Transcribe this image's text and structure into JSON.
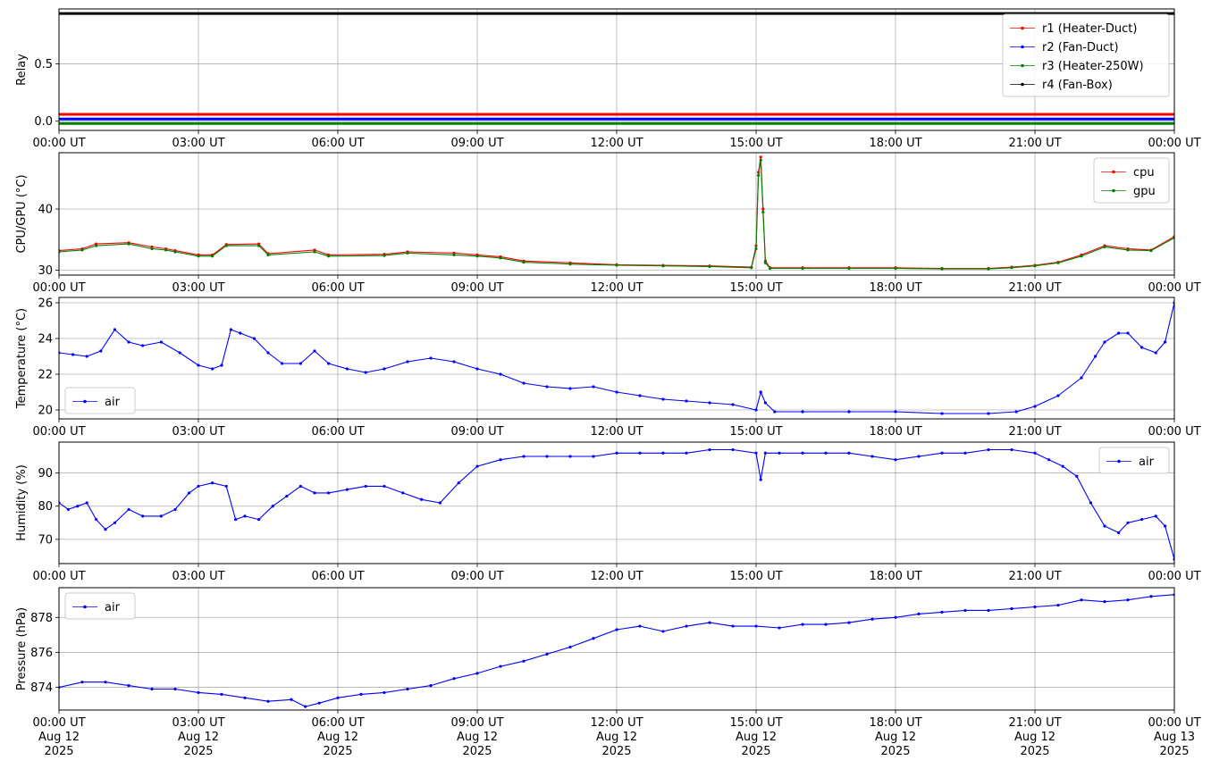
{
  "chart_data": [
    {
      "type": "line",
      "ylabel": "Relay",
      "xlim": [
        "00:00 UT",
        "00:00 UT"
      ],
      "ylim": [
        -0.08,
        0.98
      ],
      "yticks": [
        0.0,
        0.5
      ],
      "ytick_labels": [
        "0.0",
        "0.5"
      ],
      "xtick_labels": [
        "00:00 UT",
        "03:00 UT",
        "06:00 UT",
        "09:00 UT",
        "12:00 UT",
        "15:00 UT",
        "18:00 UT",
        "21:00 UT",
        "00:00 UT"
      ],
      "grid": true,
      "legend_position": "upper right",
      "series": [
        {
          "name": "r1 (Heater-Duct)",
          "color": "#ff0000",
          "x": [
            0,
            24
          ],
          "values": [
            0.06,
            0.06
          ]
        },
        {
          "name": "r2 (Fan-Duct)",
          "color": "#0000ff",
          "x": [
            0,
            24
          ],
          "values": [
            0.02,
            0.02
          ]
        },
        {
          "name": "r3 (Heater-250W)",
          "color": "#008000",
          "x": [
            0,
            24
          ],
          "values": [
            -0.02,
            -0.02
          ]
        },
        {
          "name": "r4 (Fan-Box)",
          "color": "#000000",
          "x": [
            0,
            24
          ],
          "values": [
            0.94,
            0.94
          ]
        }
      ]
    },
    {
      "type": "line",
      "ylabel": "CPU/GPU (°C)",
      "ylim": [
        29.2,
        49.2
      ],
      "yticks": [
        30,
        40
      ],
      "ytick_labels": [
        "30",
        "40"
      ],
      "xtick_labels": [
        "00:00 UT",
        "03:00 UT",
        "06:00 UT",
        "09:00 UT",
        "12:00 UT",
        "15:00 UT",
        "18:00 UT",
        "21:00 UT",
        "00:00 UT"
      ],
      "grid": true,
      "legend_position": "upper right",
      "x": [
        0,
        0.5,
        0.8,
        1.5,
        2.0,
        2.3,
        2.5,
        3.0,
        3.3,
        3.6,
        4.3,
        4.5,
        5.5,
        5.8,
        7.0,
        7.5,
        8.5,
        9.0,
        9.5,
        10.0,
        11.0,
        12.0,
        13.0,
        14.0,
        14.9,
        15.0,
        15.05,
        15.1,
        15.15,
        15.2,
        15.3,
        16.0,
        17.0,
        18.0,
        19.0,
        20.0,
        20.5,
        21.0,
        21.5,
        22.0,
        22.5,
        23.0,
        23.5,
        24.0
      ],
      "series": [
        {
          "name": "cpu",
          "color": "#ff0000",
          "values": [
            33.2,
            33.5,
            34.3,
            34.5,
            33.8,
            33.5,
            33.2,
            32.5,
            32.5,
            34.2,
            34.3,
            32.7,
            33.3,
            32.5,
            32.6,
            33.0,
            32.8,
            32.5,
            32.2,
            31.5,
            31.2,
            30.9,
            30.8,
            30.7,
            30.5,
            34.0,
            46.0,
            48.5,
            40.0,
            31.5,
            30.4,
            30.4,
            30.4,
            30.4,
            30.3,
            30.3,
            30.5,
            30.8,
            31.3,
            32.5,
            34.0,
            33.5,
            33.3,
            35.5
          ]
        },
        {
          "name": "gpu",
          "color": "#008000",
          "values": [
            33.0,
            33.3,
            34.0,
            34.3,
            33.5,
            33.3,
            33.0,
            32.3,
            32.3,
            34.0,
            34.0,
            32.5,
            33.0,
            32.3,
            32.4,
            32.8,
            32.5,
            32.3,
            32.0,
            31.3,
            31.0,
            30.8,
            30.7,
            30.6,
            30.4,
            33.5,
            45.5,
            48.0,
            39.5,
            31.2,
            30.3,
            30.3,
            30.3,
            30.3,
            30.2,
            30.2,
            30.4,
            30.7,
            31.2,
            32.3,
            33.8,
            33.3,
            33.2,
            35.3
          ]
        }
      ]
    },
    {
      "type": "line",
      "ylabel": "Temperature (°C)",
      "ylim": [
        19.5,
        26.3
      ],
      "yticks": [
        20,
        22,
        24,
        26
      ],
      "ytick_labels": [
        "20",
        "22",
        "24",
        "26"
      ],
      "xtick_labels": [
        "00:00 UT",
        "03:00 UT",
        "06:00 UT",
        "09:00 UT",
        "12:00 UT",
        "15:00 UT",
        "18:00 UT",
        "21:00 UT",
        "00:00 UT"
      ],
      "grid": true,
      "legend_position": "lower left",
      "x": [
        0,
        0.3,
        0.6,
        0.9,
        1.2,
        1.5,
        1.8,
        2.2,
        2.6,
        3.0,
        3.3,
        3.5,
        3.7,
        3.9,
        4.2,
        4.5,
        4.8,
        5.2,
        5.5,
        5.8,
        6.2,
        6.6,
        7.0,
        7.5,
        8.0,
        8.5,
        9.0,
        9.5,
        10.0,
        10.5,
        11.0,
        11.5,
        12.0,
        12.5,
        13.0,
        13.5,
        14.0,
        14.5,
        15.0,
        15.1,
        15.2,
        15.4,
        16.0,
        17.0,
        18.0,
        19.0,
        20.0,
        20.6,
        21.0,
        21.5,
        22.0,
        22.3,
        22.5,
        22.8,
        23.0,
        23.3,
        23.6,
        23.8,
        24.0
      ],
      "series": [
        {
          "name": "air",
          "color": "#0000ff",
          "values": [
            23.2,
            23.1,
            23.0,
            23.3,
            24.5,
            23.8,
            23.6,
            23.8,
            23.2,
            22.5,
            22.3,
            22.5,
            24.5,
            24.3,
            24.0,
            23.2,
            22.6,
            22.6,
            23.3,
            22.6,
            22.3,
            22.1,
            22.3,
            22.7,
            22.9,
            22.7,
            22.3,
            22.0,
            21.5,
            21.3,
            21.2,
            21.3,
            21.0,
            20.8,
            20.6,
            20.5,
            20.4,
            20.3,
            20.0,
            21.0,
            20.4,
            19.9,
            19.9,
            19.9,
            19.9,
            19.8,
            19.8,
            19.9,
            20.2,
            20.8,
            21.8,
            23.0,
            23.8,
            24.3,
            24.3,
            23.5,
            23.2,
            23.8,
            26.0
          ]
        }
      ]
    },
    {
      "type": "line",
      "ylabel": "Humidity (%)",
      "ylim": [
        62.7,
        99.3
      ],
      "yticks": [
        70,
        80,
        90
      ],
      "ytick_labels": [
        "70",
        "80",
        "90"
      ],
      "xtick_labels": [
        "00:00 UT",
        "03:00 UT",
        "06:00 UT",
        "09:00 UT",
        "12:00 UT",
        "15:00 UT",
        "18:00 UT",
        "21:00 UT",
        "00:00 UT"
      ],
      "grid": true,
      "legend_position": "upper right",
      "x": [
        0,
        0.2,
        0.4,
        0.6,
        0.8,
        1.0,
        1.2,
        1.5,
        1.8,
        2.2,
        2.5,
        2.8,
        3.0,
        3.3,
        3.6,
        3.8,
        4.0,
        4.3,
        4.6,
        4.9,
        5.2,
        5.5,
        5.8,
        6.2,
        6.6,
        7.0,
        7.4,
        7.8,
        8.2,
        8.6,
        9.0,
        9.5,
        10.0,
        10.5,
        11.0,
        11.5,
        12.0,
        12.5,
        13.0,
        13.5,
        14.0,
        14.5,
        15.0,
        15.1,
        15.2,
        15.5,
        16.0,
        16.5,
        17.0,
        17.5,
        18.0,
        18.5,
        19.0,
        19.5,
        20.0,
        20.5,
        21.0,
        21.3,
        21.6,
        21.9,
        22.2,
        22.5,
        22.8,
        23.0,
        23.3,
        23.6,
        23.8,
        24.0
      ],
      "series": [
        {
          "name": "air",
          "color": "#0000ff",
          "values": [
            81,
            79,
            80,
            81,
            76,
            73,
            75,
            79,
            77,
            77,
            79,
            84,
            86,
            87,
            86,
            76,
            77,
            76,
            80,
            83,
            86,
            84,
            84,
            85,
            86,
            86,
            84,
            82,
            81,
            87,
            92,
            94,
            95,
            95,
            95,
            95,
            96,
            96,
            96,
            96,
            97,
            97,
            96,
            88,
            96,
            96,
            96,
            96,
            96,
            95,
            94,
            95,
            96,
            96,
            97,
            97,
            96,
            94,
            92,
            89,
            81,
            74,
            72,
            75,
            76,
            77,
            74,
            64
          ]
        }
      ]
    },
    {
      "type": "line",
      "ylabel": "Pressure (hPa)",
      "ylim": [
        872.7,
        879.7
      ],
      "yticks": [
        874,
        876,
        878
      ],
      "ytick_labels": [
        "874",
        "876",
        "878"
      ],
      "xtick_labels": [
        "00:00 UT\nAug 12\n2025",
        "03:00 UT\nAug 12\n2025",
        "06:00 UT\nAug 12\n2025",
        "09:00 UT\nAug 12\n2025",
        "12:00 UT\nAug 12\n2025",
        "15:00 UT\nAug 12\n2025",
        "18:00 UT\nAug 12\n2025",
        "21:00 UT\nAug 12\n2025",
        "00:00 UT\nAug 13\n2025"
      ],
      "grid": true,
      "legend_position": "upper left",
      "x": [
        0,
        0.5,
        1.0,
        1.5,
        2.0,
        2.5,
        3.0,
        3.5,
        4.0,
        4.5,
        5.0,
        5.3,
        5.6,
        6.0,
        6.5,
        7.0,
        7.5,
        8.0,
        8.5,
        9.0,
        9.5,
        10.0,
        10.5,
        11.0,
        11.5,
        12.0,
        12.5,
        13.0,
        13.5,
        14.0,
        14.5,
        15.0,
        15.5,
        16.0,
        16.5,
        17.0,
        17.5,
        18.0,
        18.5,
        19.0,
        19.5,
        20.0,
        20.5,
        21.0,
        21.5,
        22.0,
        22.5,
        23.0,
        23.5,
        24.0
      ],
      "series": [
        {
          "name": "air",
          "color": "#0000ff",
          "values": [
            874.0,
            874.3,
            874.3,
            874.1,
            873.9,
            873.9,
            873.7,
            873.6,
            873.4,
            873.2,
            873.3,
            872.9,
            873.1,
            873.4,
            873.6,
            873.7,
            873.9,
            874.1,
            874.5,
            874.8,
            875.2,
            875.5,
            875.9,
            876.3,
            876.8,
            877.3,
            877.5,
            877.2,
            877.5,
            877.7,
            877.5,
            877.5,
            877.4,
            877.6,
            877.6,
            877.7,
            877.9,
            878.0,
            878.2,
            878.3,
            878.4,
            878.4,
            878.5,
            878.6,
            878.7,
            879.0,
            878.9,
            879.0,
            879.2,
            879.3
          ]
        }
      ]
    }
  ]
}
